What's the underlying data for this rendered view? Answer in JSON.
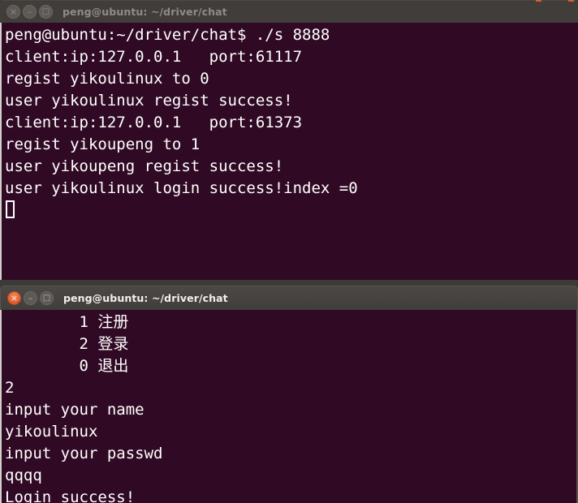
{
  "desktop": {
    "background_color": "#3c3b37"
  },
  "windows": [
    {
      "id": "server-terminal",
      "state": "inactive",
      "title": "peng@ubuntu: ~/driver/chat",
      "controls": {
        "close_label": "close-window",
        "minimize_label": "minimize-window",
        "maximize_label": "maximize-window"
      },
      "terminal": {
        "background_color": "#300a24",
        "foreground_color": "#ffffff",
        "lines": [
          "peng@ubuntu:~/driver/chat$ ./s 8888",
          "client:ip:127.0.0.1   port:61117",
          "regist yikoulinux to 0",
          "user yikoulinux regist success!",
          "client:ip:127.0.0.1   port:61373",
          "regist yikoupeng to 1",
          "user yikoupeng regist success!",
          "user yikoulinux login success!index =0"
        ],
        "cursor": "block-hollow"
      }
    },
    {
      "id": "client-terminal",
      "state": "active",
      "title": "peng@ubuntu: ~/driver/chat",
      "controls": {
        "close_label": "close-window",
        "minimize_label": "minimize-window",
        "maximize_label": "maximize-window"
      },
      "terminal": {
        "background_color": "#300a24",
        "foreground_color": "#ffffff",
        "lines": [
          "        1 注册",
          "        2 登录",
          "        0 退出",
          "2",
          "input your name",
          "yikoulinux",
          "input your passwd",
          "qqqq",
          "Login success!"
        ],
        "cursor": "none"
      }
    }
  ],
  "colors": {
    "titlebar_inactive": "#403d3a",
    "titlebar_active": "#45423f",
    "close_button_active": "#e2683d",
    "terminal_bg": "#300a24",
    "terminal_fg": "#ffffff"
  }
}
